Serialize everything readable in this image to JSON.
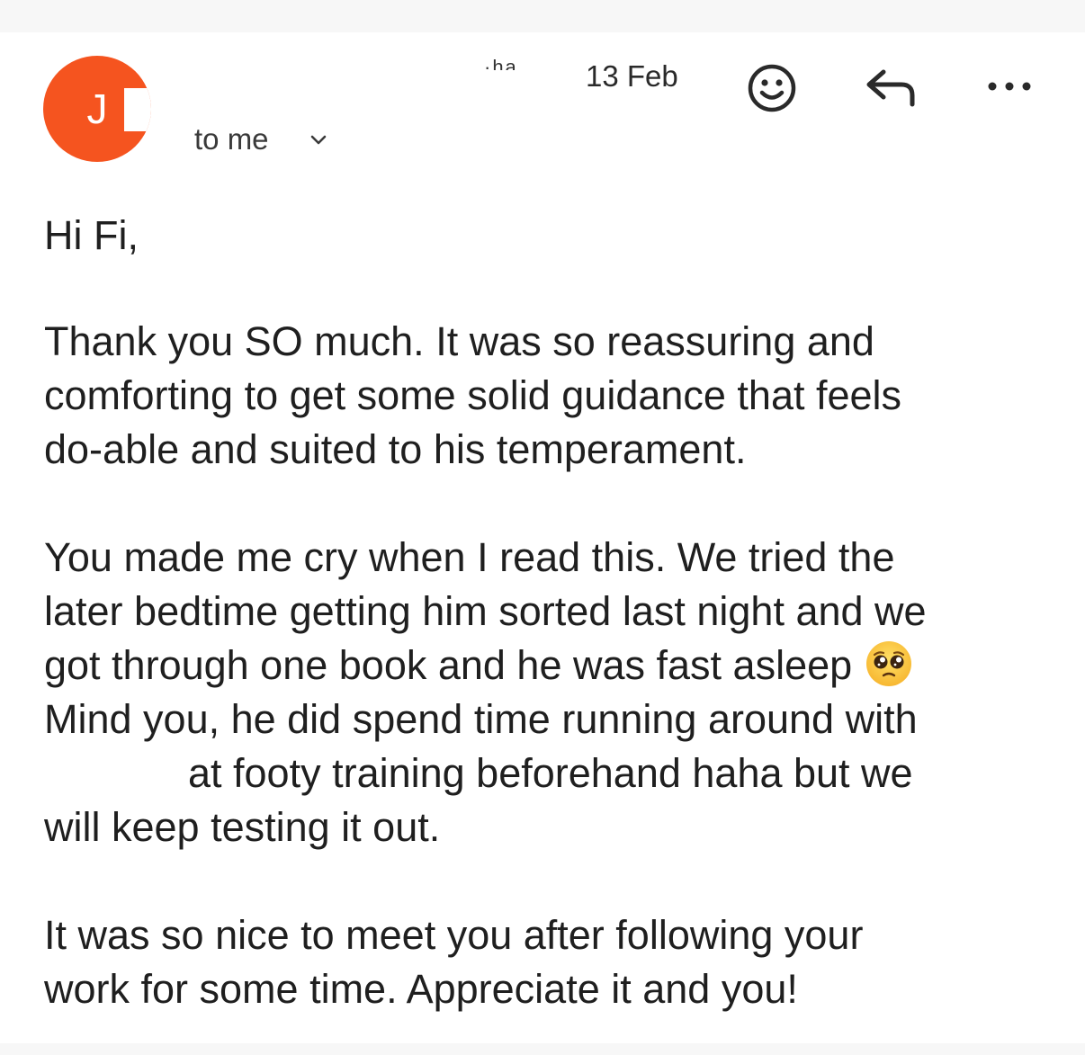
{
  "header": {
    "avatar_letter": "J",
    "sender_fragment": "·ha",
    "date": "13 Feb",
    "recipient_label": "to me",
    "icons": {
      "reaction": "smiley-icon",
      "reply": "reply-icon",
      "more": "more-options-icon",
      "expand": "chevron-down-icon"
    },
    "avatar_color": "#f5541f"
  },
  "message": {
    "greeting": "Hi Fi,",
    "paragraph1": [
      "Thank you SO much. It was so reassuring and",
      "comforting to get some solid guidance that feels",
      "do-able and suited to his temperament."
    ],
    "paragraph2": [
      "You made me cry when I read this. We tried the",
      "later bedtime getting him sorted last night and we",
      "got through one book and he was fast asleep",
      "Mind you, he did spend time running around with",
      "at footy training beforehand haha but we",
      "will keep testing it out."
    ],
    "paragraph2_emoji": "pleading-face-emoji",
    "paragraph2_redacted_fragment": "· ·-~·",
    "paragraph3": [
      "It was so nice to meet you after following your",
      "work for some time. Appreciate it and you!"
    ]
  }
}
